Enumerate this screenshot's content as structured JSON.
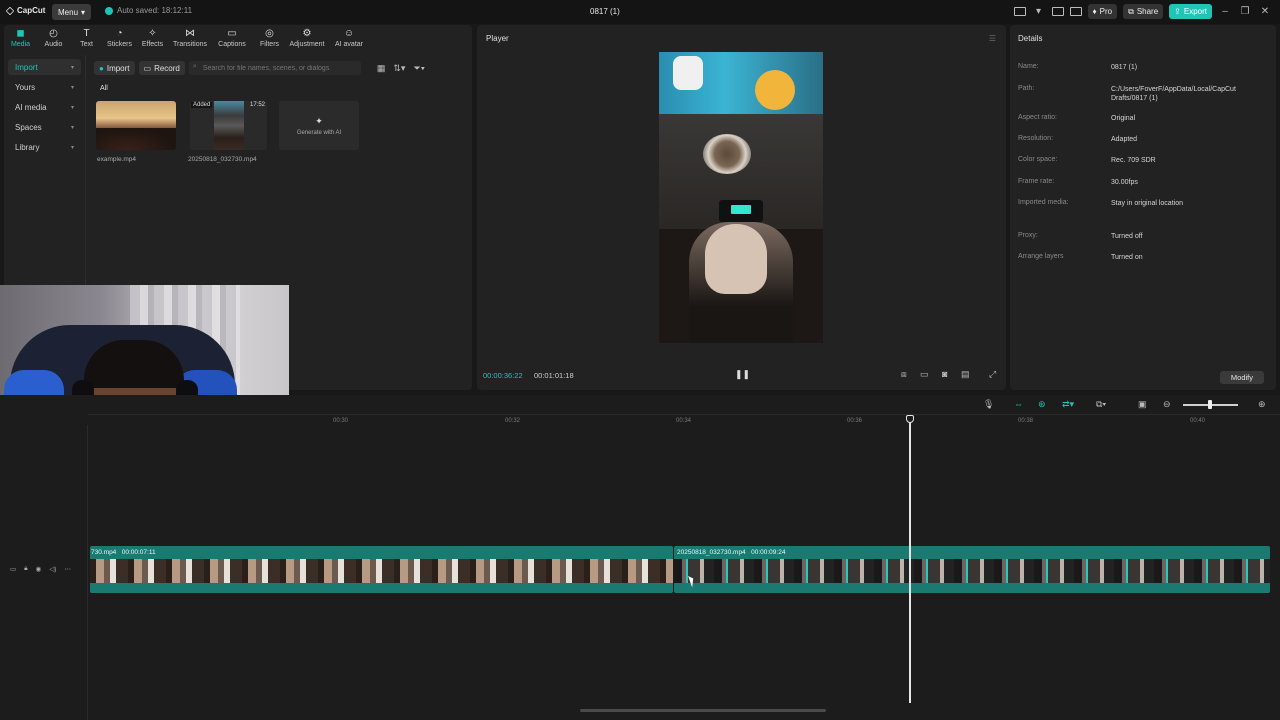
{
  "app": {
    "logo_text": "CapCut",
    "menu_label": "Menu",
    "autosave": "Auto saved: 18:12:11",
    "project_title": "0817 (1)"
  },
  "titlebar": {
    "pro_label": "Pro",
    "share_label": "Share",
    "export_label": "Export"
  },
  "tools": [
    {
      "label": "Media",
      "icon": "media-icon"
    },
    {
      "label": "Audio",
      "icon": "audio-icon"
    },
    {
      "label": "Text",
      "icon": "text-icon"
    },
    {
      "label": "Stickers",
      "icon": "stickers-icon"
    },
    {
      "label": "Effects",
      "icon": "effects-icon"
    },
    {
      "label": "Transitions",
      "icon": "transitions-icon"
    },
    {
      "label": "Captions",
      "icon": "captions-icon"
    },
    {
      "label": "Filters",
      "icon": "filters-icon"
    },
    {
      "label": "Adjustment",
      "icon": "adjustment-icon"
    },
    {
      "label": "AI avatar",
      "icon": "ai-avatar-icon"
    }
  ],
  "sidebar": {
    "items": [
      {
        "label": "Import"
      },
      {
        "label": "Yours"
      },
      {
        "label": "AI media"
      },
      {
        "label": "Spaces"
      },
      {
        "label": "Library"
      }
    ]
  },
  "media": {
    "import_label": "Import",
    "record_label": "Record",
    "search_placeholder": "Search for file names, scenes, or dialogs",
    "tab_all": "All",
    "items": [
      {
        "name": "example.mp4"
      },
      {
        "name": "20250818_032730.mp4",
        "badge": "Added",
        "duration": "17:52"
      }
    ],
    "generate_label": "Generate with AI"
  },
  "player": {
    "title": "Player",
    "current_time": "00:00:36:22",
    "total_time": "00:01:01:18"
  },
  "details": {
    "title": "Details",
    "rows": [
      {
        "label": "Name:",
        "value": "0817 (1)"
      },
      {
        "label": "Path:",
        "value": "C:/Users/FoverF/AppData/Local/CapCut Drafts/0817 (1)"
      },
      {
        "label": "Aspect ratio:",
        "value": "Original"
      },
      {
        "label": "Resolution:",
        "value": "Adapted"
      },
      {
        "label": "Color space:",
        "value": "Rec. 709 SDR"
      },
      {
        "label": "Frame rate:",
        "value": "30.00fps"
      },
      {
        "label": "Imported media:",
        "value": "Stay in original location"
      },
      {
        "label": "Proxy:",
        "value": "Turned off"
      },
      {
        "label": "Arrange layers",
        "value": "Turned on"
      }
    ],
    "modify_label": "Modify"
  },
  "timeline": {
    "ticks": [
      "00:30",
      "00:32",
      "00:34",
      "00:36",
      "00:38",
      "00:40"
    ],
    "clips": [
      {
        "name": "730.mp4",
        "duration": "00:00:07:11"
      },
      {
        "name": "20250818_032730.mp4",
        "duration": "00:00:09:24"
      }
    ]
  },
  "colors": {
    "accent": "#1fc6b8",
    "clip": "#1a7a72",
    "background": "#181818"
  }
}
